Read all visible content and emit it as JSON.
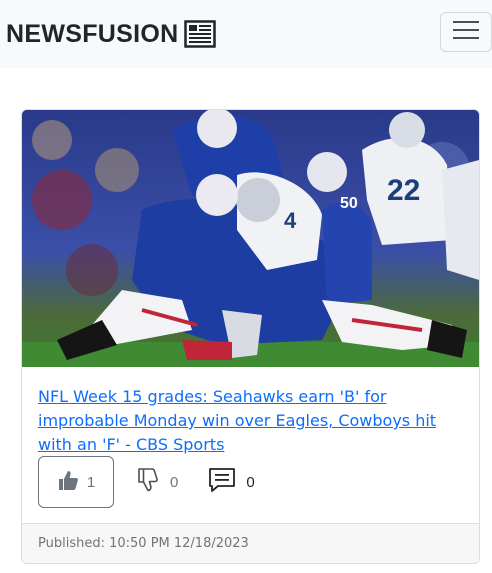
{
  "navbar": {
    "brand": "NEWSFUSION",
    "brand_icon": "newspaper-icon",
    "menu_icon": "hamburger-menu-icon"
  },
  "article": {
    "image_alt": "football players tackling",
    "headline": "NFL Week 15 grades: Seahawks earn 'B' for improbable Monday win over Eagles, Cowboys hit with an 'F' - CBS Sports",
    "likes": "1",
    "dislikes": "0",
    "comments": "0",
    "like_icon": "thumbs-up-icon",
    "dislike_icon": "thumbs-down-icon",
    "comment_icon": "comment-icon",
    "published": "Published: 10:50 PM 12/18/2023"
  },
  "colors": {
    "link": "#0d6efd",
    "navbar_bg": "#f8f9fa",
    "muted": "#6c757d"
  }
}
